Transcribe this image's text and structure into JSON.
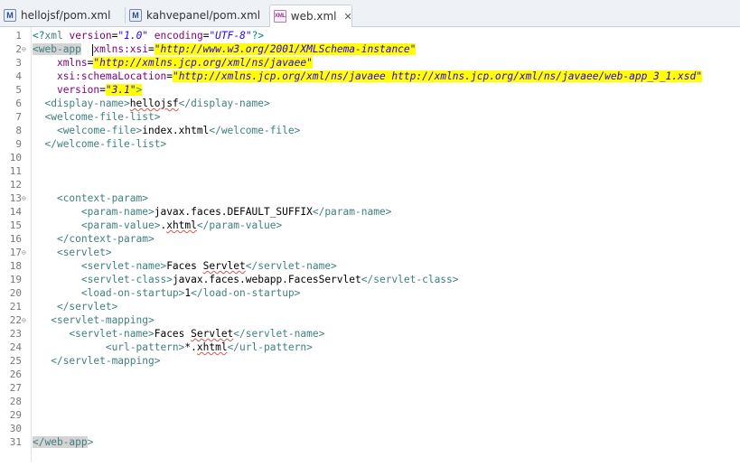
{
  "tabs": [
    {
      "label": "hellojsf/pom.xml",
      "icon": "maven-pom-icon"
    },
    {
      "label": "kahvepanel/pom.xml",
      "icon": "maven-pom-icon"
    },
    {
      "label": "web.xml",
      "icon": "xml-file-icon",
      "active": true
    }
  ],
  "icon_text": {
    "maven": "M",
    "xml": "XML",
    "close": "✕"
  },
  "line_numbers": [
    "1",
    "2",
    "3",
    "4",
    "5",
    "6",
    "7",
    "8",
    "9",
    "10",
    "11",
    "12",
    "13",
    "14",
    "15",
    "16",
    "17",
    "18",
    "19",
    "20",
    "21",
    "22",
    "23",
    "24",
    "25",
    "26",
    "27",
    "28",
    "29",
    "30",
    "31"
  ],
  "code": {
    "l1": {
      "open": "<?",
      "xml": "xml",
      "a1": "version",
      "v1": "\"1.0\"",
      "a2": "encoding",
      "v2": "\"UTF-8\"",
      "close": "?>"
    },
    "l2": {
      "lt": "<",
      "tag": "web-app",
      "a1": "xmlns:xsi",
      "v1": "\"http://www.w3.org/2001/XMLSchema-instance\""
    },
    "l3": {
      "a": "xmlns",
      "v": "\"http://xmlns.jcp.org/xml/ns/javaee\""
    },
    "l4": {
      "a": "xsi:schemaLocation",
      "v": "\"http://xmlns.jcp.org/xml/ns/javaee http://xmlns.jcp.org/xml/ns/javaee/web-app_3_1.xsd\""
    },
    "l5": {
      "a": "version",
      "v": "\"3.1\"",
      "gt": ">"
    },
    "l6": {
      "open": "<display-name>",
      "text": "hellojsf",
      "close": "</display-name>"
    },
    "l7": {
      "open": "<welcome-file-list>"
    },
    "l8": {
      "open": "<welcome-file>",
      "text": "index.xhtml",
      "close": "</welcome-file>"
    },
    "l9": {
      "close": "</welcome-file-list>"
    },
    "l13": {
      "open": "<context-param>"
    },
    "l14": {
      "open": "<param-name>",
      "text": "javax.faces.DEFAULT_SUFFIX",
      "close": "</param-name>"
    },
    "l15": {
      "open": "<param-value>",
      "text1": ".",
      "text2": "xhtml",
      "close": "</param-value>"
    },
    "l16": {
      "close": "</context-param>"
    },
    "l17": {
      "open": "<servlet>"
    },
    "l18": {
      "open": "<servlet-name>",
      "text1": "Faces ",
      "text2": "Servlet",
      "close": "</servlet-name>"
    },
    "l19": {
      "open": "<servlet-class>",
      "text": "javax.faces.webapp.FacesServlet",
      "close": "</servlet-class>"
    },
    "l20": {
      "open": "<load-on-startup>",
      "text": "1",
      "close": "</load-on-startup>"
    },
    "l21": {
      "close": "</servlet>"
    },
    "l22": {
      "open": "<servlet-mapping>"
    },
    "l23": {
      "open": "<servlet-name>",
      "text1": "Faces ",
      "text2": "Servlet",
      "close": "</servlet-name>"
    },
    "l24": {
      "open": "<url-pattern>",
      "text1": "*.",
      "text2": "xhtml",
      "close": "</url-pattern>"
    },
    "l25": {
      "close": "</servlet-mapping>"
    },
    "l31": {
      "lt": "</",
      "tag": "web-app",
      "gt": ">"
    }
  },
  "colors": {
    "tag": "#3f7f7f",
    "attribute": "#7f007f",
    "value": "#2a00ff",
    "highlight": "#ffff00"
  }
}
